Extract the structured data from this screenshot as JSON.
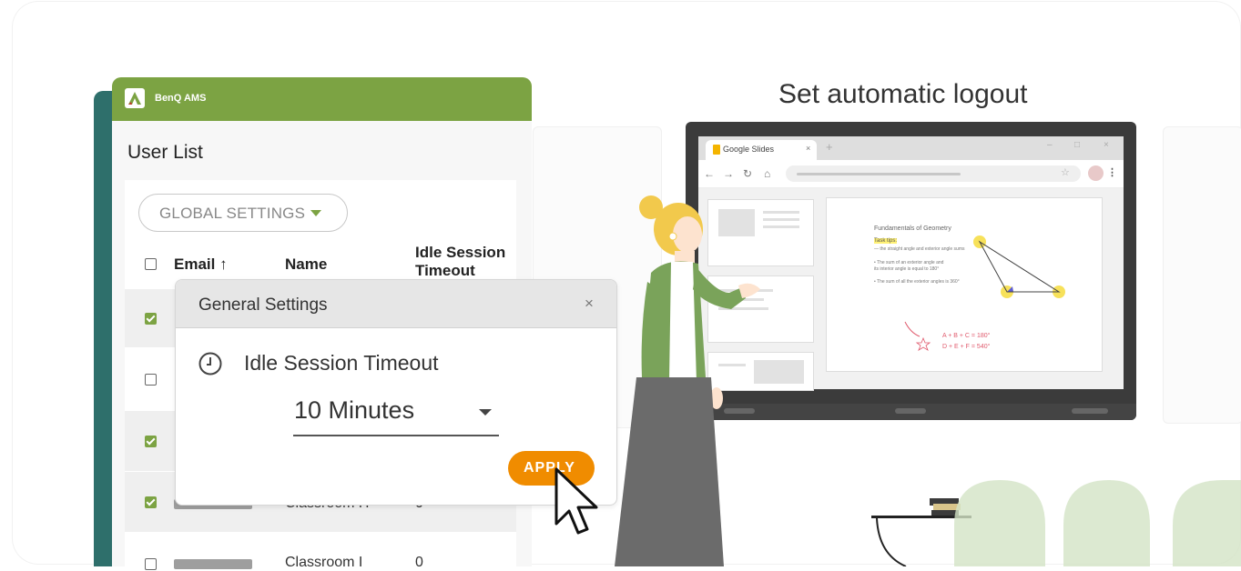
{
  "ams": {
    "app_name": "BenQ AMS",
    "page_title": "User List",
    "global_settings_label": "GLOBAL SETTINGS",
    "columns": {
      "email": "Email ↑",
      "name": "Name",
      "idle_timeout": "Idle Session Timeout"
    },
    "rows": [
      {
        "checked": true,
        "name": "",
        "timeout": ""
      },
      {
        "checked": false,
        "name": "",
        "timeout": ""
      },
      {
        "checked": true,
        "name": "",
        "timeout": ""
      },
      {
        "checked": true,
        "name": "Classroom H",
        "timeout": "0"
      },
      {
        "checked": false,
        "name": "Classroom I",
        "timeout": "0"
      }
    ]
  },
  "dialog": {
    "title": "General Settings",
    "close": "×",
    "setting_label": "Idle Session Timeout",
    "selected_value": "10 Minutes",
    "apply_label": "APPLY"
  },
  "headline": "Set automatic logout",
  "browser": {
    "tab_label": "Google Slides",
    "tab_close": "×",
    "new_tab": "+",
    "slide": {
      "title": "Fundamentals of Geometry",
      "highlight": "Task tips:",
      "lines": [
        "— the straight angle and exterior angle sums",
        "• The sum of an exterior angle and",
        "  its interior angle is equal to 180°",
        "• The sum of all the exterior angles is 360°"
      ],
      "eq1": "A + B + C = 180°",
      "eq2": "D + E + F = 540°"
    }
  },
  "colors": {
    "brand_green": "#7ca343",
    "teal": "#2e6f6b",
    "apply_orange": "#f08c00"
  }
}
